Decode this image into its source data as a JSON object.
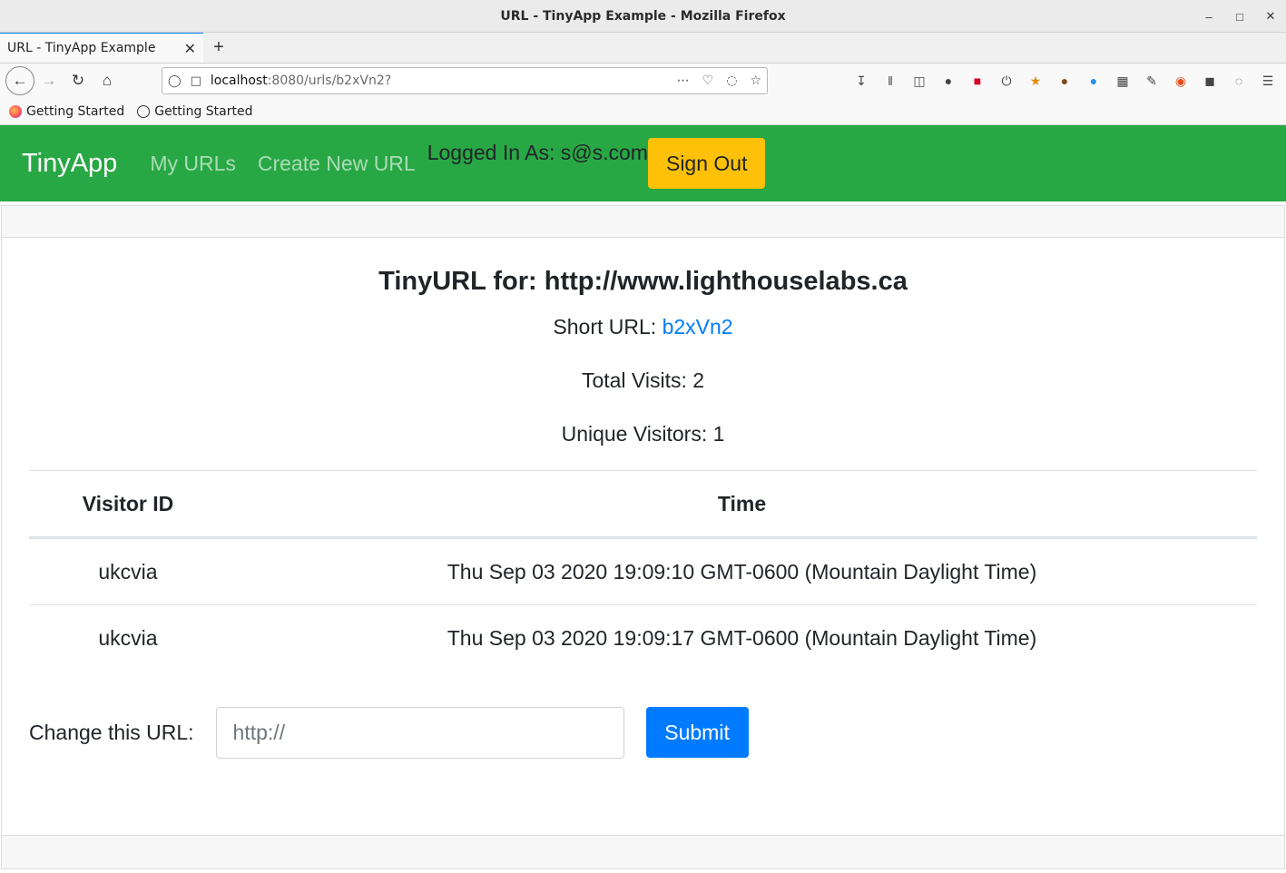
{
  "window": {
    "title": "URL - TinyApp Example - Mozilla Firefox"
  },
  "tab": {
    "label": "URL - TinyApp Example"
  },
  "urlbar": {
    "host": "localhost",
    "path": ":8080/urls/b2xVn2?"
  },
  "bookmarks": [
    {
      "label": "Getting Started"
    },
    {
      "label": "Getting Started"
    }
  ],
  "nav": {
    "brand": "TinyApp",
    "my_urls": "My URLs",
    "create_new": "Create New URL",
    "logged_in": "Logged In As: s@s.com",
    "sign_out": "Sign Out",
    "color": "#28a745"
  },
  "main": {
    "title": "TinyURL for: http://www.lighthouselabs.ca",
    "short_url_label": "Short URL: ",
    "short_url": "b2xVn2",
    "total_visits": "Total Visits: 2",
    "unique_visitors": "Unique Visitors: 1"
  },
  "table": {
    "headers": [
      "Visitor ID",
      "Time"
    ],
    "rows": [
      [
        "ukcvia",
        "Thu Sep 03 2020 19:09:10 GMT-0600 (Mountain Daylight Time)"
      ],
      [
        "ukcvia",
        "Thu Sep 03 2020 19:09:17 GMT-0600 (Mountain Daylight Time)"
      ]
    ]
  },
  "form": {
    "label": "Change this URL:",
    "placeholder": "http://",
    "submit": "Submit"
  }
}
